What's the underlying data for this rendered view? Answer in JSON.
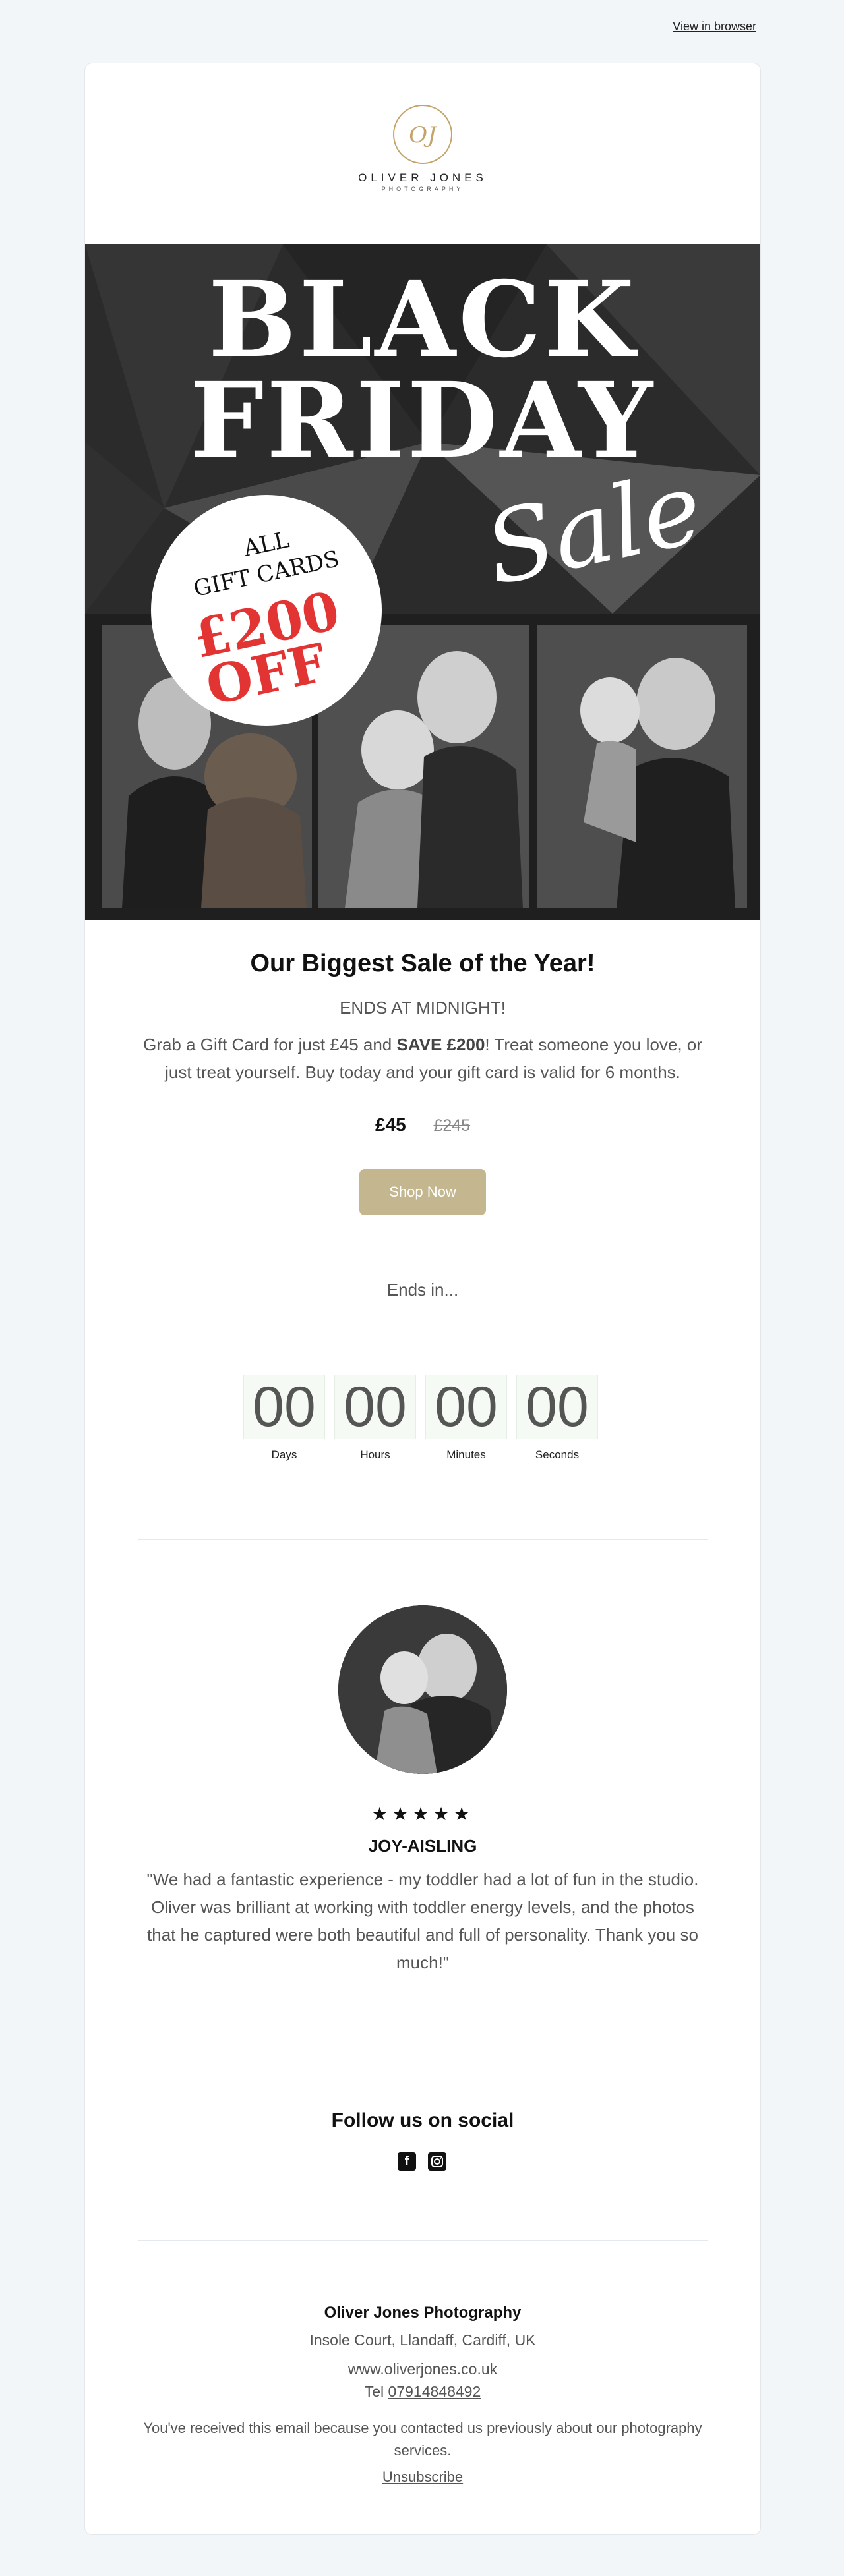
{
  "header": {
    "view_in_browser": "View in browser"
  },
  "brand": {
    "name": "OLIVER JONES",
    "tagline": "PHOTOGRAPHY",
    "monogram": "OJ"
  },
  "hero": {
    "line1": "BLACK",
    "line2": "FRIDAY",
    "script": "Sale",
    "badge": {
      "line1": "ALL",
      "line2": "GIFT CARDS",
      "amount": "£200",
      "off": "OFF"
    }
  },
  "offer": {
    "title": "Our Biggest Sale of the Year!",
    "ends": "ENDS AT MIDNIGHT!",
    "body_pre": "Grab a Gift Card for just £45 and ",
    "body_bold": "SAVE £200",
    "body_post": "!  Treat someone you love, or just treat yourself. Buy today and your gift card is valid for 6 months.",
    "price_now": "£45",
    "price_was": "£245",
    "cta": "Shop Now"
  },
  "countdown": {
    "heading": "Ends in...",
    "units": [
      {
        "value": "00",
        "label": "Days"
      },
      {
        "value": "00",
        "label": "Hours"
      },
      {
        "value": "00",
        "label": "Minutes"
      },
      {
        "value": "00",
        "label": "Seconds"
      }
    ]
  },
  "review": {
    "stars": "★★★★★",
    "name": "JOY-AISLING",
    "quote": "\"We had a fantastic experience - my toddler had a lot of fun in the studio. Oliver was brilliant at working with toddler energy levels, and the photos that he captured were both beautiful and full of personality. Thank you so much!\""
  },
  "social": {
    "title": "Follow us on social",
    "icons": [
      "facebook-icon",
      "instagram-icon"
    ]
  },
  "footer": {
    "company": "Oliver Jones Photography",
    "address": "Insole Court, Llandaff, Cardiff, UK",
    "website": "www.oliverjones.co.uk",
    "tel_label": "Tel ",
    "tel": "07914848492",
    "note": "You've received this email because you contacted us previously about our photography services.",
    "unsubscribe": "Unsubscribe"
  },
  "colors": {
    "accent": "#c4b68e",
    "sale_red": "#e33434",
    "background": "#f3f6f9"
  }
}
